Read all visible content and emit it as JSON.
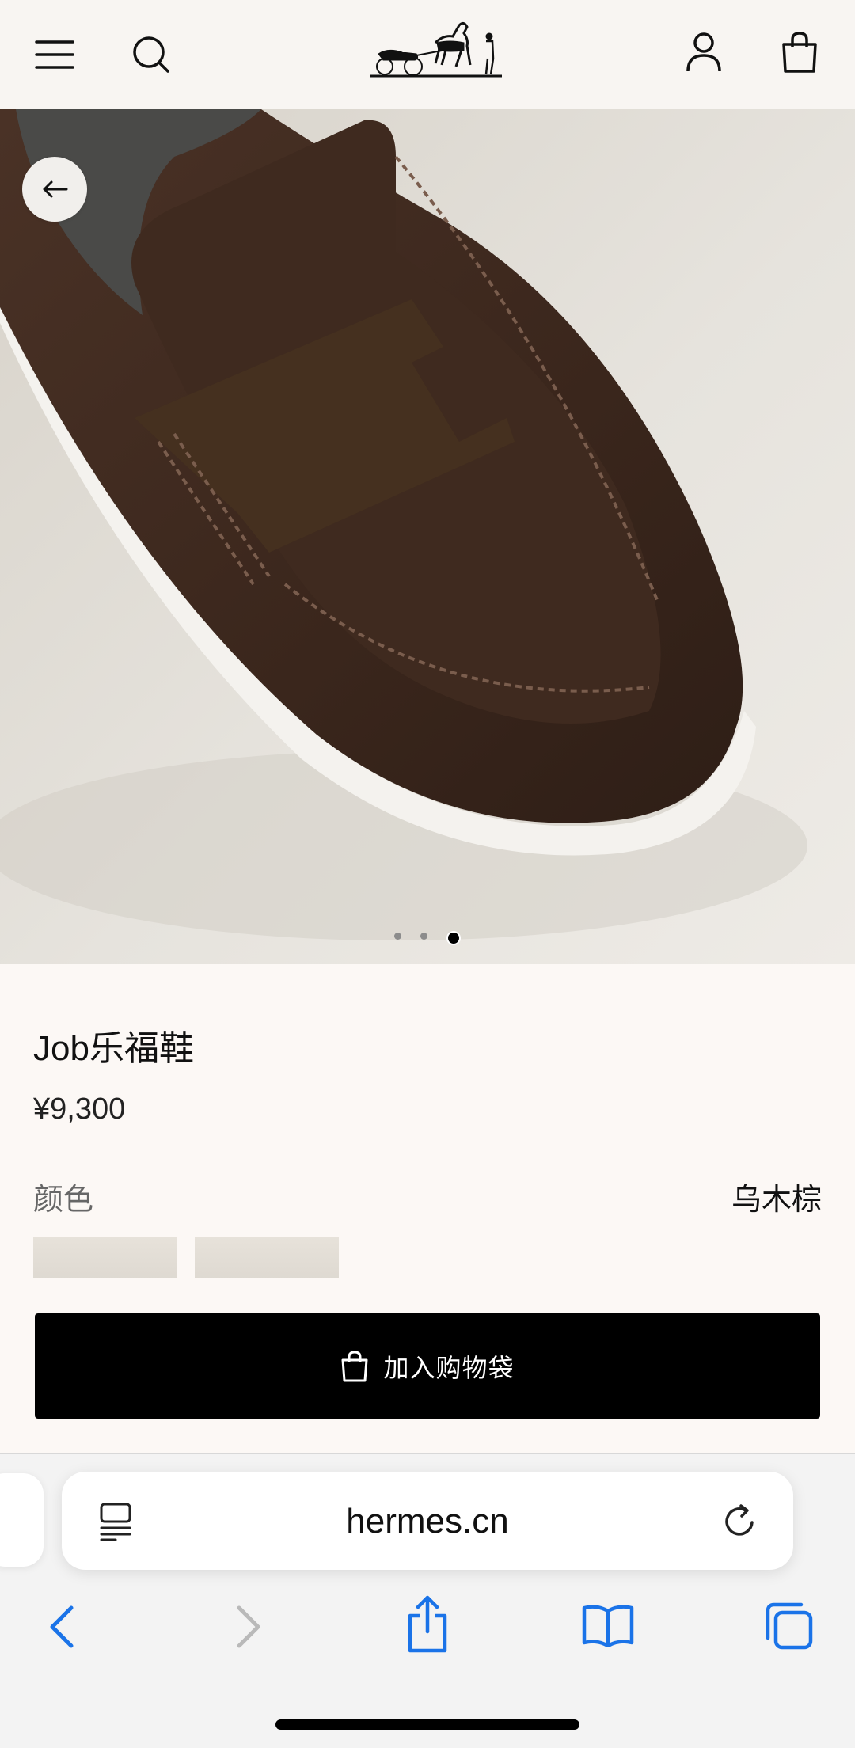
{
  "header": {
    "menu_icon": "hamburger-menu-icon",
    "search_icon": "search-icon",
    "logo": "hermes-carriage-logo",
    "account_icon": "user-icon",
    "bag_icon": "shopping-bag-icon"
  },
  "gallery": {
    "back_icon": "arrow-left-icon",
    "slides": 3,
    "current_slide": 3
  },
  "product": {
    "name": "Job乐福鞋",
    "price": "¥9,300",
    "color_label": "颜色",
    "color_value": "乌木棕",
    "add_to_bag": "加入购物袋"
  },
  "browser": {
    "url": "hermes.cn",
    "reader_icon": "reader-mode-icon",
    "reload_icon": "reload-icon",
    "back_icon": "chevron-left-icon",
    "forward_icon": "chevron-right-icon",
    "share_icon": "share-icon",
    "bookmarks_icon": "book-icon",
    "tabs_icon": "tabs-icon"
  },
  "colors": {
    "accent_blue": "#1a73e8",
    "button_bg": "#000000",
    "page_bg": "#fcf8f5"
  }
}
